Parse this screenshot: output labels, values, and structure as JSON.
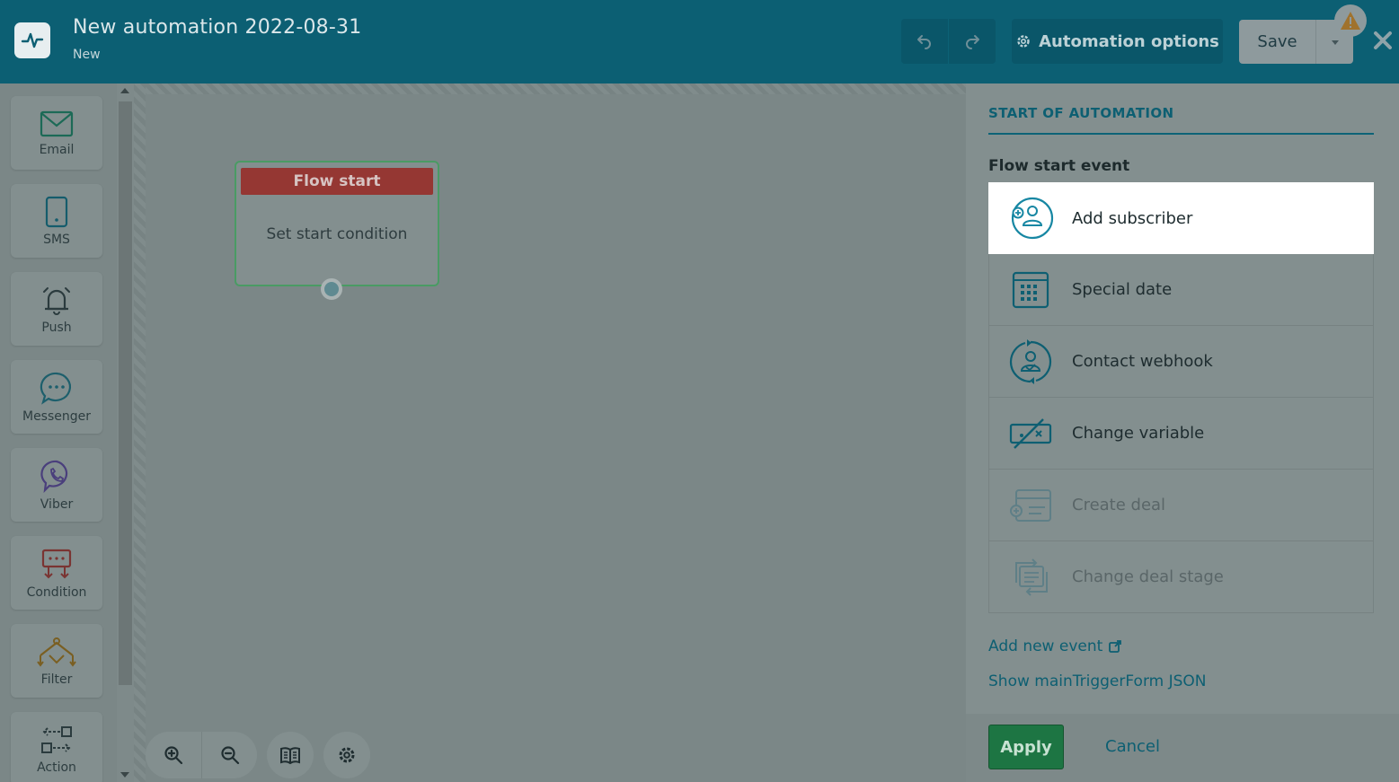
{
  "header": {
    "title": "New automation 2022-08-31",
    "status": "New",
    "options_label": "Automation options",
    "save_label": "Save"
  },
  "palette": {
    "items": [
      {
        "label": "Email",
        "icon": "mail-icon"
      },
      {
        "label": "SMS",
        "icon": "phone-icon"
      },
      {
        "label": "Push",
        "icon": "bell-icon"
      },
      {
        "label": "Messenger",
        "icon": "chat-bubble-icon"
      },
      {
        "label": "Viber",
        "icon": "viber-icon"
      },
      {
        "label": "Condition",
        "icon": "condition-icon"
      },
      {
        "label": "Filter",
        "icon": "filter-icon"
      },
      {
        "label": "Action",
        "icon": "action-icon"
      }
    ]
  },
  "canvas": {
    "node_title": "Flow start",
    "node_body": "Set start condition"
  },
  "panel": {
    "heading": "START OF AUTOMATION",
    "section_label": "Flow start event",
    "events": [
      {
        "label": "Add subscriber",
        "icon": "add-subscriber-icon",
        "state": "selected"
      },
      {
        "label": "Special date",
        "icon": "calendar-icon",
        "state": "enabled"
      },
      {
        "label": "Contact webhook",
        "icon": "webhook-icon",
        "state": "enabled"
      },
      {
        "label": "Change variable",
        "icon": "variable-icon",
        "state": "enabled"
      },
      {
        "label": "Create deal",
        "icon": "create-deal-icon",
        "state": "disabled"
      },
      {
        "label": "Change deal stage",
        "icon": "deal-stage-icon",
        "state": "disabled"
      }
    ],
    "add_event_link": "Add new event",
    "json_link": "Show mainTriggerForm JSON",
    "apply_label": "Apply",
    "cancel_label": "Cancel"
  },
  "colors": {
    "header_bg": "#0c5f73",
    "accent": "#0d5f72",
    "flow_start_red": "#953733",
    "apply_green": "#1d7543"
  }
}
